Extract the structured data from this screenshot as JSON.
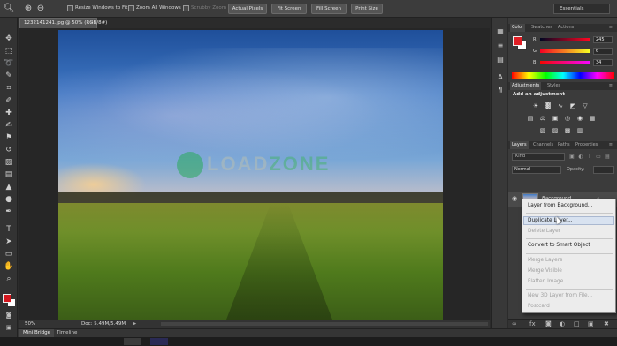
{
  "options_bar": {
    "resize_windows": "Resize Windows to Fit",
    "zoom_all_windows": "Zoom All Windows",
    "scrubby_zoom": "Scrubby Zoom",
    "actual_pixels": "Actual Pixels",
    "fit_screen": "Fit Screen",
    "fill_screen": "Fill Screen",
    "print_size": "Print Size",
    "workspace": "Essentials"
  },
  "document": {
    "tab_title": "1232141241.jpg @ 50% (RGB/8#)",
    "tab_close": "×",
    "zoom": "50%",
    "doc_size": "Doc: 5.49M/5.49M",
    "status_arrow": "▶"
  },
  "watermark": {
    "part1": "LOAD",
    "part2": "ZONE"
  },
  "bottom_tabs": {
    "mini_bridge": "Mini Bridge",
    "timeline": "Timeline"
  },
  "color_panel": {
    "tabs": [
      "Color",
      "Swatches",
      "Actions"
    ],
    "channels": [
      {
        "ch": "R",
        "value": "245"
      },
      {
        "ch": "G",
        "value": "6"
      },
      {
        "ch": "B",
        "value": "34"
      }
    ],
    "fg": "#e01e24",
    "bg": "#ffffff"
  },
  "adjustments_panel": {
    "tabs": [
      "Adjustments",
      "Styles"
    ],
    "title": "Add an adjustment"
  },
  "layers_panel": {
    "tabs": [
      "Layers",
      "Channels",
      "Paths",
      "Properties"
    ],
    "kind_filter": "Kind",
    "blend_mode": "Normal",
    "opacity_label": "Opacity:",
    "layer_name": "Background"
  },
  "context_menu": {
    "items": [
      {
        "label": "Layer from Background...",
        "enabled": true,
        "hover": false
      },
      {
        "label": "Duplicate Layer...",
        "enabled": true,
        "hover": true
      },
      {
        "label": "Delete Layer",
        "enabled": false,
        "hover": false
      },
      {
        "label": "Convert to Smart Object",
        "enabled": true,
        "hover": false
      },
      {
        "label": "Merge Layers",
        "enabled": false,
        "hover": false
      },
      {
        "label": "Merge Visible",
        "enabled": false,
        "hover": false
      },
      {
        "label": "Flatten Image",
        "enabled": false,
        "hover": false
      },
      {
        "label": "New 3D Layer from File...",
        "enabled": false,
        "hover": false
      },
      {
        "label": "Postcard",
        "enabled": false,
        "hover": false
      }
    ]
  },
  "toolbox": {
    "fg_color": "#d3171e",
    "bg_color": "#ffffff"
  }
}
